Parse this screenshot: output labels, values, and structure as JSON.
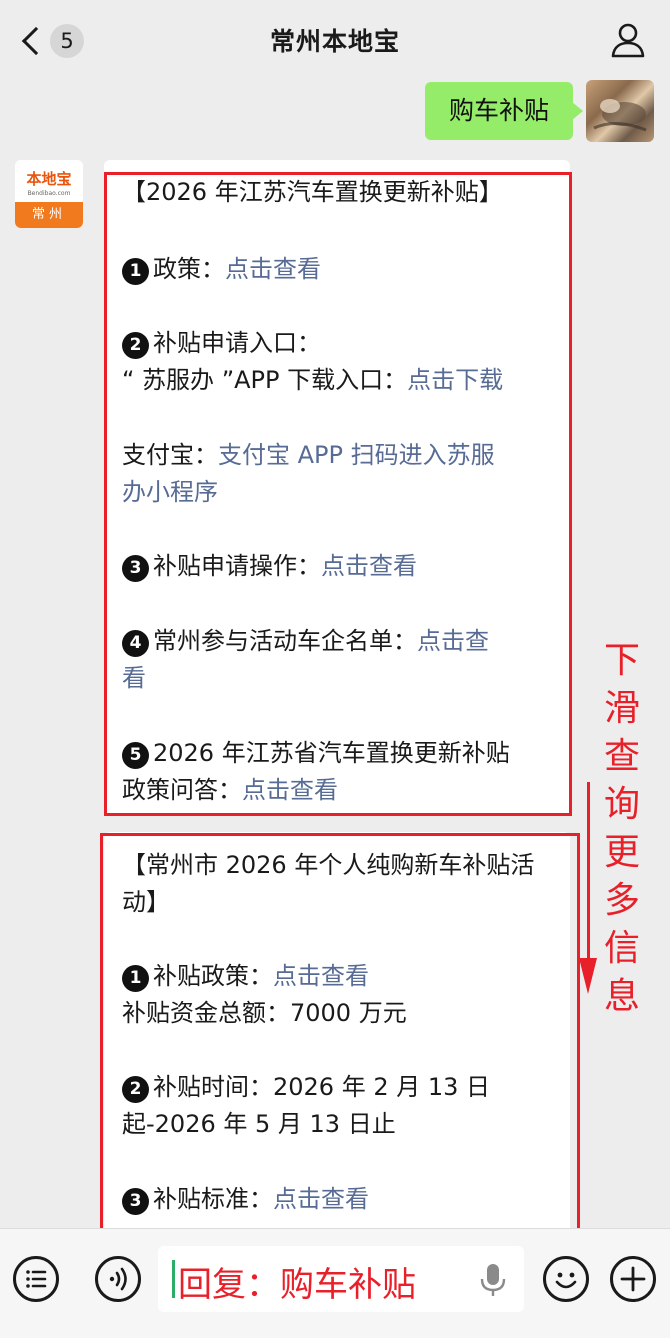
{
  "header": {
    "title": "常州本地宝",
    "unread_count": "5"
  },
  "outgoing": {
    "text": "购车补贴"
  },
  "bot_avatar": {
    "logo": "本地宝",
    "url": "Bendibao.com",
    "city": "常州"
  },
  "card1": {
    "title": "【2026 年江苏汽车置换更新补贴】",
    "item1_label": "政策：",
    "item1_link": "点击查看",
    "item2_label": "补贴申请入口：",
    "item2_line2_label": "“ 苏服办 ”APP 下载入口：",
    "item2_line2_link": "点击下载",
    "alipay_label": "支付宝：",
    "alipay_link_1": "支付宝 APP 扫码进入苏服",
    "alipay_link_2": "办小程序",
    "item3_label": "补贴申请操作：",
    "item3_link": "点击查看",
    "item4_label": "常州参与活动车企名单：",
    "item4_link_1": "点击查",
    "item4_link_2": "看",
    "item5_label_1": "2026 年江苏省汽车置换更新补贴",
    "item5_label_2": "政策问答：",
    "item5_link": "点击查看"
  },
  "card2": {
    "title_1": "【常州市 2026 年个人纯购新车补贴活",
    "title_2": "动】",
    "item1_label": "补贴政策：",
    "item1_link": "点击查看",
    "fund_line": "补贴资金总额：7000 万元",
    "item2_label": "补贴时间：2026 年 2 月 13 日",
    "item2_line2": "起-2026 年 5 月 13 日止",
    "item3_label": "补贴标准：",
    "item3_link": "点击查看"
  },
  "numbers": {
    "n1": "1",
    "n2": "2",
    "n3": "3",
    "n4": "4",
    "n5": "5"
  },
  "annotation": {
    "chars": [
      "下",
      "滑",
      "查",
      "询",
      "更",
      "多",
      "信",
      "息"
    ]
  },
  "input": {
    "text": "回复：购车补贴"
  },
  "colors": {
    "bubble_out": "#95ec69",
    "link": "#576b95",
    "annotation_red": "#e8202a",
    "brand_orange": "#f07a1d"
  },
  "icons": [
    "back-chevron-icon",
    "profile-icon",
    "menu-list-icon",
    "voice-icon",
    "mic-icon",
    "emoji-icon",
    "plus-icon"
  ]
}
